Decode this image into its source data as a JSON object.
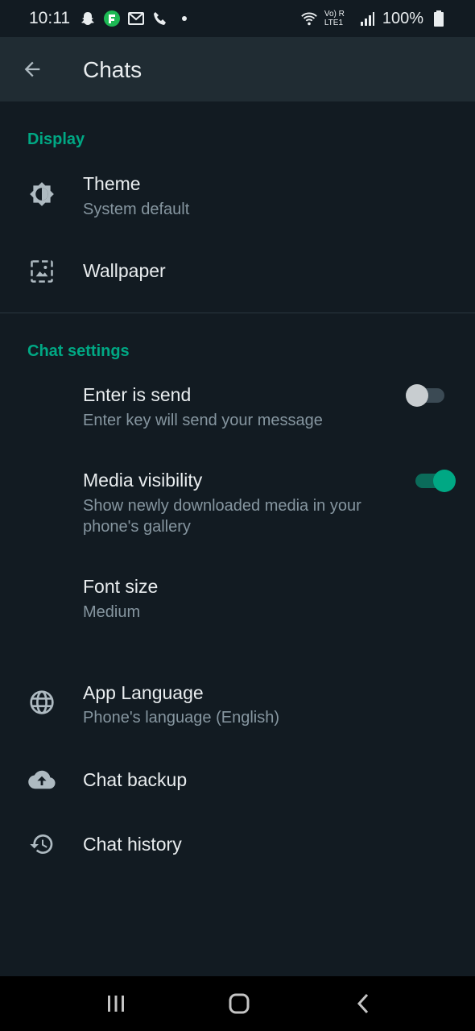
{
  "status_bar": {
    "time": "10:11",
    "battery": "100%",
    "network_label": "Vo) R LTE1"
  },
  "app_bar": {
    "title": "Chats"
  },
  "sections": {
    "display": {
      "header": "Display",
      "theme": {
        "title": "Theme",
        "subtitle": "System default"
      },
      "wallpaper": {
        "title": "Wallpaper"
      }
    },
    "chat_settings": {
      "header": "Chat settings",
      "enter_is_send": {
        "title": "Enter is send",
        "subtitle": "Enter key will send your message",
        "enabled": false
      },
      "media_visibility": {
        "title": "Media visibility",
        "subtitle": "Show newly downloaded media in your phone's gallery",
        "enabled": true
      },
      "font_size": {
        "title": "Font size",
        "subtitle": "Medium"
      }
    },
    "more": {
      "app_language": {
        "title": "App Language",
        "subtitle": "Phone's language (English)"
      },
      "chat_backup": {
        "title": "Chat backup"
      },
      "chat_history": {
        "title": "Chat history"
      }
    }
  },
  "colors": {
    "accent": "#00a884",
    "background": "#121b22",
    "app_bar": "#202c33",
    "secondary_text": "#8696a0"
  }
}
